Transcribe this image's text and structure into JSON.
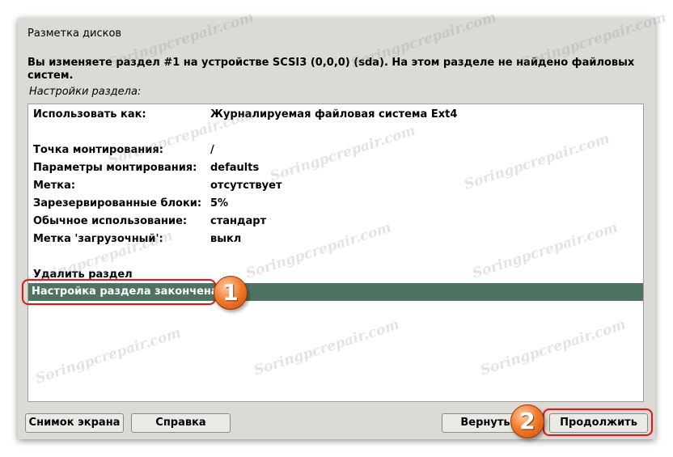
{
  "window": {
    "title": "Разметка дисков",
    "description": "Вы изменяете раздел #1 на устройстве SCSI3 (0,0,0) (sda). На этом разделе не найдено файловых систем.",
    "subtitle": "Настройки раздела:"
  },
  "settings": [
    {
      "label": "Использовать как:",
      "value": "Журналируемая файловая система Ext4"
    },
    {
      "label": "Точка монтирования:",
      "value": "/"
    },
    {
      "label": "Параметры монтирования:",
      "value": "defaults"
    },
    {
      "label": "Метка:",
      "value": "отсутствует"
    },
    {
      "label": "Зарезервированные блоки:",
      "value": "5%"
    },
    {
      "label": "Обычное использование:",
      "value": "стандарт"
    },
    {
      "label": "Метка 'загрузочный':",
      "value": "выкл"
    }
  ],
  "actions": {
    "delete": "Удалить раздел",
    "done": "Настройка раздела закончена"
  },
  "buttons": {
    "screenshot": "Снимок экрана",
    "help": "Справка",
    "back": "Вернуть",
    "continue": "Продолжить"
  },
  "callouts": {
    "one": "1",
    "two": "2"
  },
  "watermark": "Soringpcrepair.com",
  "colors": {
    "selection": "#4f7363",
    "callout": "#d31c1c",
    "badge": "#f07b2a"
  }
}
